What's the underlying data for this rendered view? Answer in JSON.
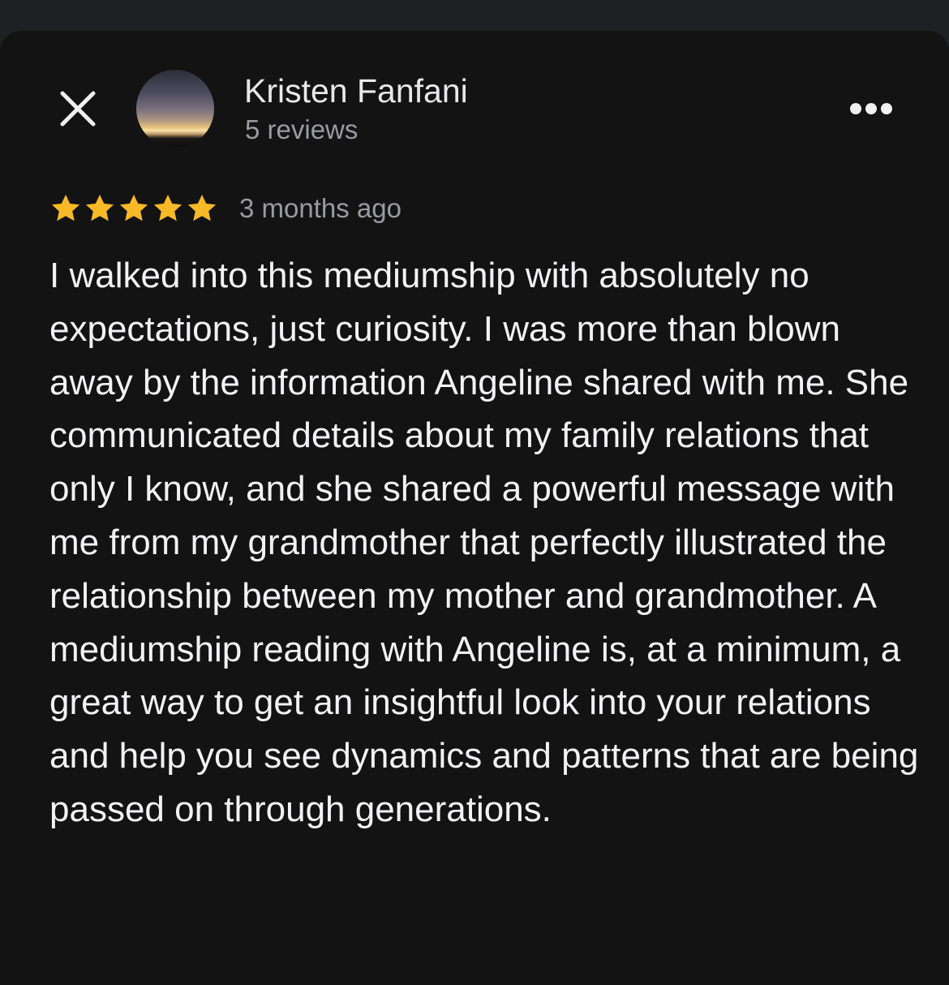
{
  "reviewer": {
    "name": "Kristen Fanfani",
    "review_count": "5 reviews"
  },
  "review": {
    "rating": 5,
    "rating_max": 5,
    "time_ago": "3 months ago",
    "text": "I walked into this mediumship with absolutely no expectations, just curiosity. I was more than blown away by the information Angeline shared with me. She communicated details about my family relations that only I know, and she shared a powerful message with me from my grandmother that perfectly illustrated the relationship between my mother and grandmother. A mediumship reading with Angeline is, at a minimum, a great way to get an insightful look into your relations and help you see dynamics and patterns that are being passed on through generations."
  },
  "icons": {
    "close": "close-icon",
    "more": "more-horizontal-icon",
    "star": "star-icon"
  },
  "colors": {
    "background": "#131313",
    "star": "#f7b928",
    "primary_text": "#f2f2f4",
    "secondary_text": "#9a9ba0"
  }
}
